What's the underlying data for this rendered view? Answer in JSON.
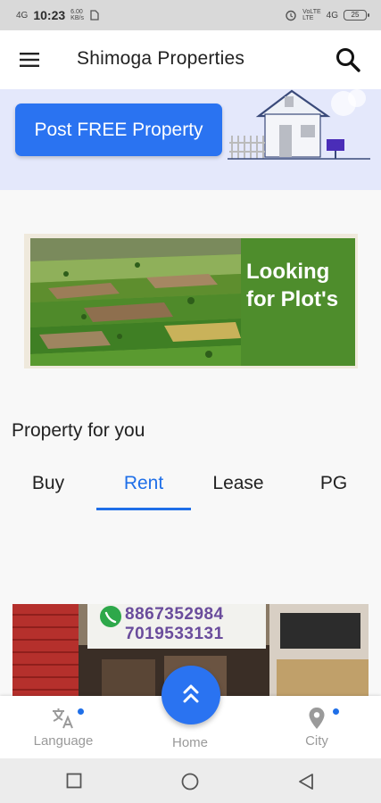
{
  "status_bar": {
    "network_label": "4G",
    "time": "10:23",
    "data_speed_value": "6.00",
    "data_speed_unit": "KB/s",
    "right_network_top": "VoLTE",
    "right_network_bottom": "LTE",
    "right_network_4g": "4G",
    "battery_level": "25"
  },
  "app_bar": {
    "title": "Shimoga Properties"
  },
  "post_banner": {
    "button_label": "Post FREE Property"
  },
  "plot_ad": {
    "line1": "Looking",
    "line2": "for Plot's"
  },
  "section": {
    "title": "Property for you"
  },
  "tabs": [
    {
      "label": "Buy",
      "active": false
    },
    {
      "label": "Rent",
      "active": true
    },
    {
      "label": "Lease",
      "active": false
    },
    {
      "label": "PG",
      "active": false
    }
  ],
  "property_card": {
    "phone_1": "8867352984",
    "phone_2": "7019533131"
  },
  "bottom_nav": {
    "language_label": "Language",
    "home_label": "Home",
    "city_label": "City"
  },
  "colors": {
    "accent": "#1f6fe8",
    "button": "#2a73f1",
    "banner_bg": "#e4e8fb",
    "ad_green": "#4e8d2c"
  },
  "icons": {
    "menu": "menu-icon",
    "search": "search-icon",
    "language": "translate-icon",
    "home": "double-chevron-up-icon",
    "city": "location-pin-icon"
  }
}
